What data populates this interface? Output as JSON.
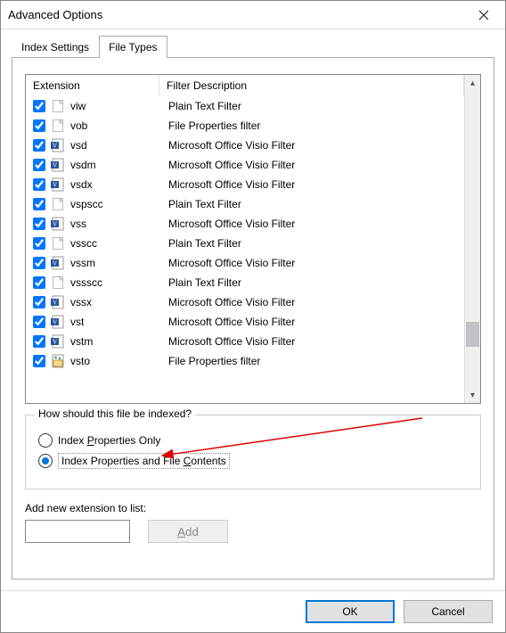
{
  "window": {
    "title": "Advanced Options"
  },
  "tabs": [
    {
      "label": "Index Settings",
      "active": false
    },
    {
      "label": "File Types",
      "active": true
    }
  ],
  "list": {
    "header": {
      "ext": "Extension",
      "fd": "Filter Description"
    },
    "rows": [
      {
        "checked": true,
        "icon": "blank",
        "ext": "viw",
        "fd": "Plain Text Filter"
      },
      {
        "checked": true,
        "icon": "blank",
        "ext": "vob",
        "fd": "File Properties filter"
      },
      {
        "checked": true,
        "icon": "visio",
        "ext": "vsd",
        "fd": "Microsoft Office Visio Filter"
      },
      {
        "checked": true,
        "icon": "visio",
        "ext": "vsdm",
        "fd": "Microsoft Office Visio Filter"
      },
      {
        "checked": true,
        "icon": "visio",
        "ext": "vsdx",
        "fd": "Microsoft Office Visio Filter"
      },
      {
        "checked": true,
        "icon": "blank",
        "ext": "vspscc",
        "fd": "Plain Text Filter"
      },
      {
        "checked": true,
        "icon": "visio",
        "ext": "vss",
        "fd": "Microsoft Office Visio Filter"
      },
      {
        "checked": true,
        "icon": "blank",
        "ext": "vsscc",
        "fd": "Plain Text Filter"
      },
      {
        "checked": true,
        "icon": "visio",
        "ext": "vssm",
        "fd": "Microsoft Office Visio Filter"
      },
      {
        "checked": true,
        "icon": "blank",
        "ext": "vssscc",
        "fd": "Plain Text Filter"
      },
      {
        "checked": true,
        "icon": "visio",
        "ext": "vssx",
        "fd": "Microsoft Office Visio Filter"
      },
      {
        "checked": true,
        "icon": "visio",
        "ext": "vst",
        "fd": "Microsoft Office Visio Filter"
      },
      {
        "checked": true,
        "icon": "visio",
        "ext": "vstm",
        "fd": "Microsoft Office Visio Filter"
      },
      {
        "checked": true,
        "icon": "app",
        "ext": "vsto",
        "fd": "File Properties filter"
      }
    ]
  },
  "group": {
    "label": "How should this file be indexed?",
    "opt1_pre": "Index ",
    "opt1_u": "P",
    "opt1_post": "roperties Only",
    "opt2_pre": "Index Properties and File ",
    "opt2_u": "C",
    "opt2_post": "ontents",
    "selected": 2
  },
  "add": {
    "label": "Add new extension to list:",
    "btn_u": "A",
    "btn_post": "dd",
    "value": ""
  },
  "footer": {
    "ok": "OK",
    "cancel": "Cancel"
  },
  "icons": {
    "blank": "#ffffff",
    "visio_bg": "#2b579a",
    "app_bg": "#f5d98c"
  }
}
